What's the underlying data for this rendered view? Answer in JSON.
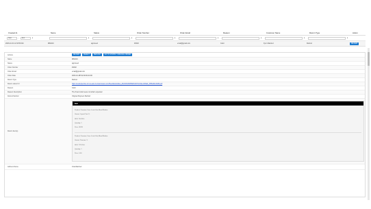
{
  "columns": [
    {
      "label": "Created At"
    },
    {
      "label": "Name"
    },
    {
      "label": "Status"
    },
    {
      "label": "Order Number"
    },
    {
      "label": "Order Email"
    },
    {
      "label": "Reason"
    },
    {
      "label": "Customer Name"
    },
    {
      "label": "Return Type"
    },
    {
      "label": "Action"
    }
  ],
  "filters": {
    "date_from": "Start",
    "date_to": "End",
    "funnel_icon": "filter-icon"
  },
  "row": {
    "created_at": "2023-10-31 12:34:56 AM",
    "name": "#RA010",
    "status": "approved",
    "order_number": "#1002",
    "order_email": "email@gmail.com",
    "reason": "Color",
    "customer_name": "Fynn Ramirez",
    "return_type": "Refund",
    "action_label": "REVIEW"
  },
  "detail": {
    "actions_label": "Actions",
    "buttons": [
      "REVIEW",
      "REJECT",
      "REFUND",
      "GO TO SHOPIFY ORIGINAL ORDER"
    ],
    "fields": [
      {
        "label": "Name",
        "value": "#RA010"
      },
      {
        "label": "Status",
        "value": "approved"
      },
      {
        "label": "Order Number",
        "value": "#1002"
      },
      {
        "label": "Order Email",
        "value": "email@gmail.com"
      },
      {
        "label": "Order Date",
        "value": "2023-10-28T12:00:00-04:00"
      },
      {
        "label": "Return Type",
        "value": "Refund"
      },
      {
        "label": "Return Label Url",
        "value": "https://example-files.s3.us-east-2.amazonaws.com/files/labels/label_d6c0b3b3b8f5d45c97b1b3de1f4f4a9_6f56db1b4b89.pdf",
        "link": true
      },
      {
        "label": "Reason",
        "value": "Color"
      },
      {
        "label": "Reason Description",
        "value": "The fit and color were not what I expected"
      },
      {
        "label": "Refund Method",
        "value": "Original Payment Method"
      }
    ],
    "return_items_label": "Return Item(s)",
    "items_header": "Item",
    "items": [
      {
        "product": "Product: Premium Crew Crush Skin Blend Medias",
        "variant": "Variant: Crystal Teal / L",
        "sku": "SKU: TS-ICE-L",
        "quantity": "Quantity: 1",
        "price": "Price: 49.99"
      },
      {
        "product": "Product: Premium Crew Crush Skin Blend Medias",
        "variant": "Variant: Titanium / L",
        "sku": "SKU: TIT-ICE-L",
        "quantity": "Quantity: 1",
        "price": "Price: 0.00"
      }
    ],
    "address_label": "Address Name",
    "address_value": "Cina Ramirez"
  }
}
